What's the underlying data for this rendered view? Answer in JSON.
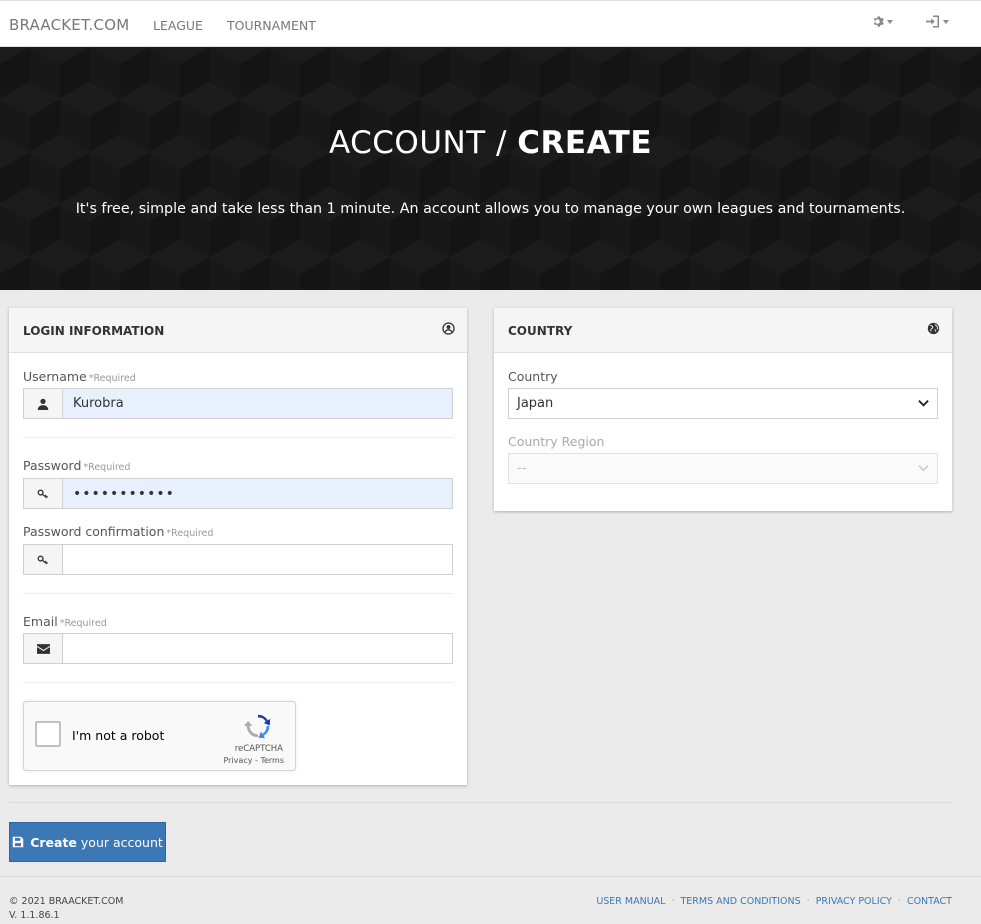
{
  "nav": {
    "brand": "BRAACKET.COM",
    "links": [
      "LEAGUE",
      "TOURNAMENT"
    ],
    "icons": [
      "gear-icon",
      "sign-in-icon"
    ]
  },
  "hero": {
    "title_light": "ACCOUNT / ",
    "title_bold": "CREATE",
    "subtitle": "It's free, simple and take less than 1 minute. An account allows you to manage your own leagues and tournaments."
  },
  "login_panel": {
    "title": "LOGIN INFORMATION",
    "required_tag": "*Required",
    "username_label": "Username",
    "username_value": "Kurobra",
    "password_label": "Password",
    "password_value": "•••••••••••",
    "password_confirm_label": "Password confirmation",
    "email_label": "Email",
    "recaptcha": {
      "label": "I'm not a robot",
      "brand": "reCAPTCHA",
      "privacy": "Privacy",
      "separator": " - ",
      "terms": "Terms"
    }
  },
  "country_panel": {
    "title": "COUNTRY",
    "country_label": "Country",
    "country_value": "Japan",
    "region_label": "Country Region",
    "region_value": "--"
  },
  "actions": {
    "create_bold": "Create",
    "create_rest": " your account"
  },
  "footer": {
    "copyright": "© 2021 BRAACKET.COM",
    "version": "V. 1.1.86.1",
    "links": [
      "USER MANUAL",
      "TERMS AND CONDITIONS",
      "PRIVACY POLICY",
      "CONTACT"
    ]
  },
  "colors": {
    "primary": "#3b78b5",
    "autofill": "#e8f0fe",
    "hero_bg": "#141414"
  }
}
